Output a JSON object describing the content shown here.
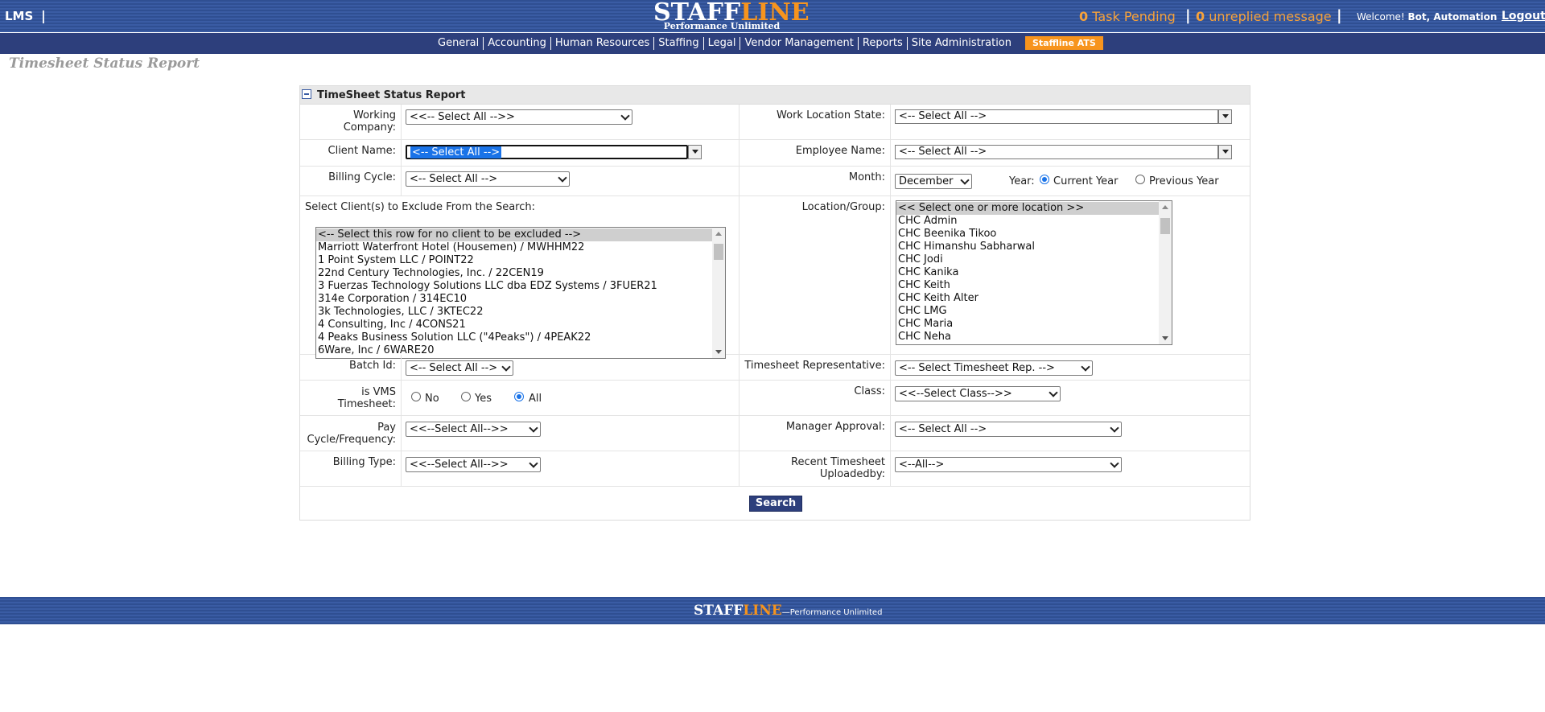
{
  "header": {
    "app": "LMS",
    "logo_staff": "STAFF",
    "logo_line": "LINE",
    "logo_tagline": "Performance Unlimited",
    "tasks_count": "0",
    "tasks_label": "Task Pending",
    "messages_count": "0",
    "messages_label": "unreplied message",
    "welcome_label": "Welcome!",
    "user": "Bot, Automation",
    "logout": "Logout"
  },
  "nav": {
    "items": [
      "General",
      "Accounting",
      "Human Resources",
      "Staffing",
      "Legal",
      "Vendor Management",
      "Reports",
      "Site Administration"
    ],
    "ats": "Staffline ATS"
  },
  "page_title": "Timesheet Status Report",
  "panel": {
    "title": "TimeSheet Status Report",
    "working_company": {
      "label": "Working Company:",
      "value": "<<-- Select All -->>"
    },
    "work_location_state": {
      "label": "Work Location State:",
      "value": "<-- Select All -->"
    },
    "client_name": {
      "label": "Client Name:",
      "value": "<-- Select All -->"
    },
    "employee_name": {
      "label": "Employee Name:",
      "value": "<-- Select All -->"
    },
    "billing_cycle": {
      "label": "Billing Cycle:",
      "value": "<-- Select All -->"
    },
    "month": {
      "label": "Month:",
      "value": "December"
    },
    "year": {
      "label": "Year:",
      "current": "Current Year",
      "previous": "Previous Year"
    },
    "exclude_clients": {
      "label": "Select Client(s) to Exclude From the Search:",
      "options": [
        "<-- Select this row for no client to be excluded -->",
        "Marriott Waterfront Hotel (Housemen) / MWHHM22",
        "1 Point System LLC / POINT22",
        "22nd Century Technologies, Inc. / 22CEN19",
        "3 Fuerzas Technology Solutions LLC dba EDZ Systems / 3FUER21",
        "314e Corporation / 314EC10",
        "3k Technologies, LLC / 3KTEC22",
        "4 Consulting, Inc / 4CONS21",
        "4 Peaks Business Solution LLC (\"4Peaks\") / 4PEAK22",
        "6Ware, Inc / 6WARE20"
      ]
    },
    "location_group": {
      "label": "Location/Group:",
      "options": [
        "<< Select one or more location >>",
        "CHC Admin",
        "CHC Beenika Tikoo",
        "CHC Himanshu Sabharwal",
        "CHC Jodi",
        "CHC Kanika",
        "CHC Keith",
        "CHC Keith Alter",
        "CHC LMG",
        "CHC Maria",
        "CHC Neha"
      ]
    },
    "batch_id": {
      "label": "Batch Id:",
      "value": "<-- Select All -->"
    },
    "timesheet_rep": {
      "label": "Timesheet Representative:",
      "value": "<-- Select Timesheet Rep. -->"
    },
    "is_vms": {
      "label_line1": "is VMS",
      "label_line2": "Timesheet:",
      "no": "No",
      "yes": "Yes",
      "all": "All"
    },
    "class": {
      "label": "Class:",
      "value": "<<--Select Class-->>"
    },
    "pay_cycle": {
      "label_line1": "Pay",
      "label_line2": "Cycle/Frequency:",
      "value": "<<--Select All-->>"
    },
    "manager_approval": {
      "label": "Manager Approval:",
      "value": "<-- Select All -->"
    },
    "billing_type": {
      "label": "Billing Type:",
      "value": "<<--Select All-->>"
    },
    "recent_uploaded": {
      "label_line1": "Recent Timesheet",
      "label_line2": "Uploadedby:",
      "value": "<--All-->"
    },
    "search": "Search"
  },
  "footer": {
    "staff": "STAFF",
    "line": "LINE",
    "tagline": "—Performance Unlimited"
  }
}
